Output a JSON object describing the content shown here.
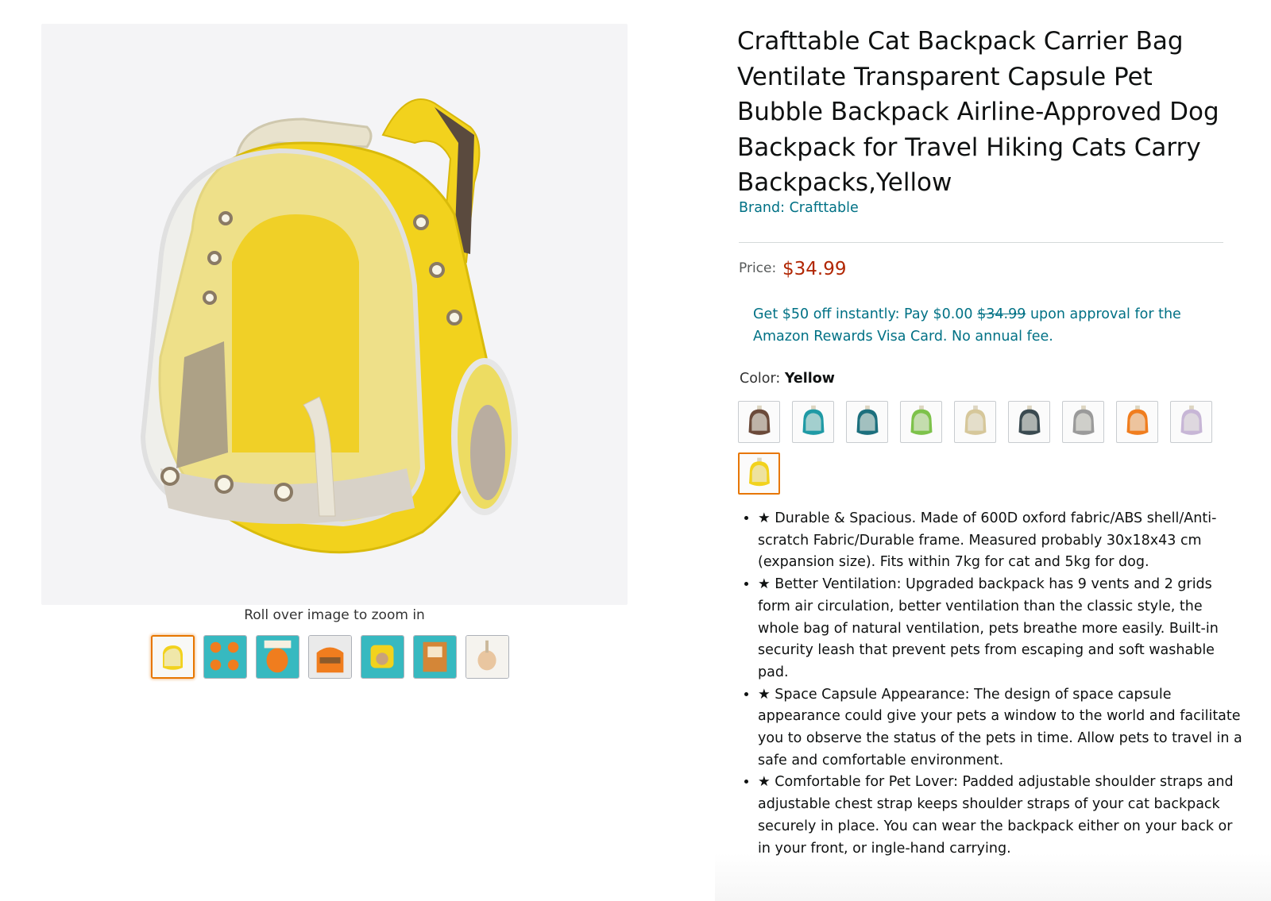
{
  "product": {
    "title": "Crafttable Cat Backpack Carrier Bag Ventilate Transparent Capsule Pet Bubble Backpack Airline-Approved Dog Backpack for Travel Hiking Cats Carry Backpacks,Yellow",
    "brand": "Brand: Crafttable"
  },
  "image_viewer": {
    "zoom_hint": "Roll over image to zoom in",
    "thumbnail_count": 7,
    "selected_thumbnail": 0
  },
  "price": {
    "label": "Price:",
    "value": "$34.99"
  },
  "promo": {
    "text_before": "Get $50 off instantly: Pay $0.00 ",
    "struck_price": "$34.99",
    "text_after": " upon approval for the Amazon Rewards Visa Card. No annual fee."
  },
  "color": {
    "label": "Color: ",
    "selected": "Yellow",
    "swatches": [
      {
        "name": "brown-swatch",
        "color": "#6b4a3a"
      },
      {
        "name": "teal-swatch",
        "color": "#1f9aa5"
      },
      {
        "name": "dark-teal-swatch",
        "color": "#1c6f7d"
      },
      {
        "name": "green-swatch",
        "color": "#7dc24a"
      },
      {
        "name": "beige-swatch",
        "color": "#d6c79a"
      },
      {
        "name": "black-swatch",
        "color": "#3a4a50"
      },
      {
        "name": "grey-swatch",
        "color": "#9a9a9a"
      },
      {
        "name": "orange-swatch",
        "color": "#f07d1e"
      },
      {
        "name": "lavender-swatch",
        "color": "#c7b6d6"
      },
      {
        "name": "yellow-swatch",
        "color": "#f2d21d"
      }
    ],
    "selected_index": 9
  },
  "bullets": [
    "★ Durable & Spacious. Made of 600D oxford fabric/ABS shell/Anti-scratch Fabric/Durable frame. Measured probably 30x18x43 cm (expansion size). Fits within 7kg for cat and 5kg for dog.",
    "★ Better Ventilation: Upgraded backpack has 9 vents and 2 grids form air circulation, better ventilation than the classic style, the whole bag of natural ventilation, pets breathe more easily. Built-in security leash that prevent pets from escaping and soft washable pad.",
    "★ Space Capsule Appearance: The design of space capsule appearance could give your pets a window to the world and facilitate you to observe the status of the pets in time. Allow pets to travel in a safe and comfortable environment.",
    "★ Comfortable for Pet Lover: Padded adjustable shoulder straps and adjustable chest strap keeps shoulder straps of your cat backpack securely in place. You can wear the backpack either on your back or in your front, or ingle-hand carrying."
  ],
  "colors": {
    "link": "#007185",
    "price": "#b12704",
    "selected_border": "#e77600",
    "product_yellow": "#f2d21d"
  }
}
